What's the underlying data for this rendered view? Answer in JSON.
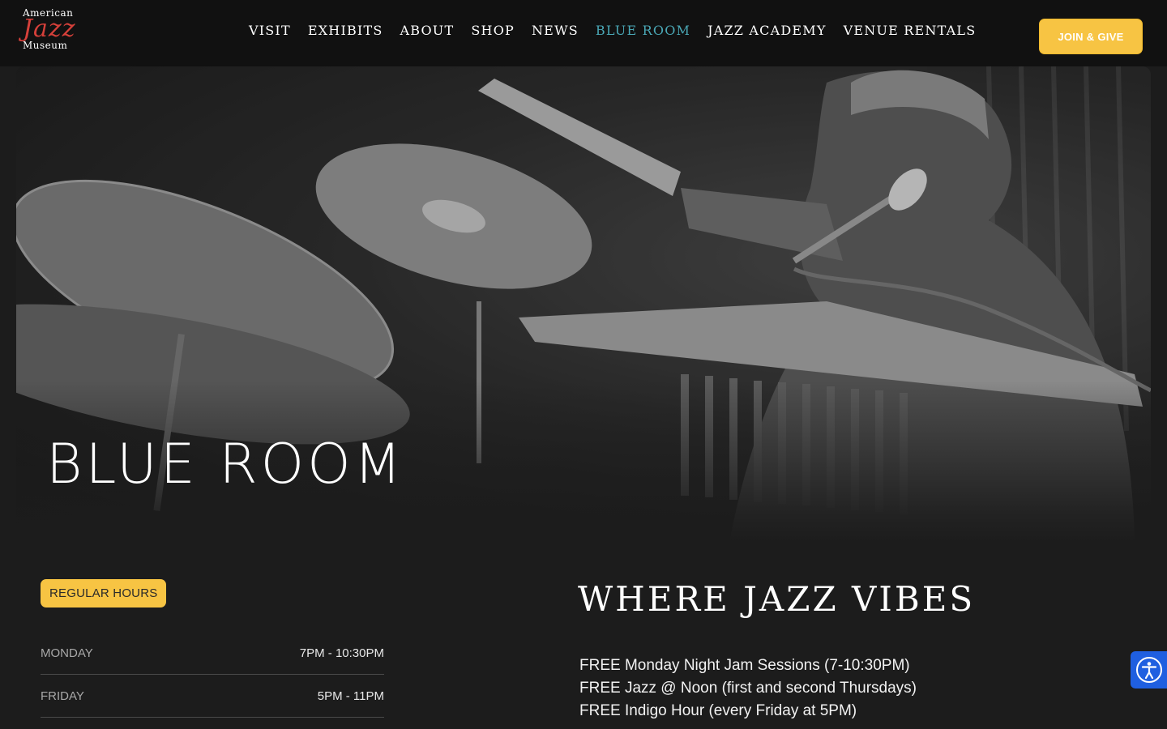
{
  "header": {
    "logo": {
      "line1": "American",
      "line2": "Jazz",
      "line3": "Museum"
    },
    "nav": [
      {
        "label": "VISIT"
      },
      {
        "label": "EXHIBITS"
      },
      {
        "label": "ABOUT"
      },
      {
        "label": "SHOP"
      },
      {
        "label": "NEWS"
      },
      {
        "label": "BLUE ROOM",
        "active": true
      },
      {
        "label": "JAZZ ACADEMY"
      },
      {
        "label": "VENUE RENTALS"
      }
    ],
    "cta_label": "JOIN & GIVE"
  },
  "hero": {
    "title": "BLUE ROOM"
  },
  "hours": {
    "badge": "REGULAR HOURS",
    "rows": [
      {
        "day": "MONDAY",
        "time": "7PM - 10:30PM"
      },
      {
        "day": "FRIDAY",
        "time": "5PM - 11PM"
      }
    ]
  },
  "vibes": {
    "title": "WHERE JAZZ VIBES",
    "items": [
      "FREE Monday Night Jam Sessions (7-10:30PM)",
      "FREE Jazz @ Noon (first and second Thursdays)",
      "FREE Indigo Hour (every Friday at 5PM)"
    ]
  },
  "accessibility": {
    "icon": "accessibility-icon"
  },
  "colors": {
    "accent": "#f7c443",
    "active_nav": "#4aa8b6",
    "background": "#1c1c1c",
    "a11y": "#1f5fe0"
  }
}
